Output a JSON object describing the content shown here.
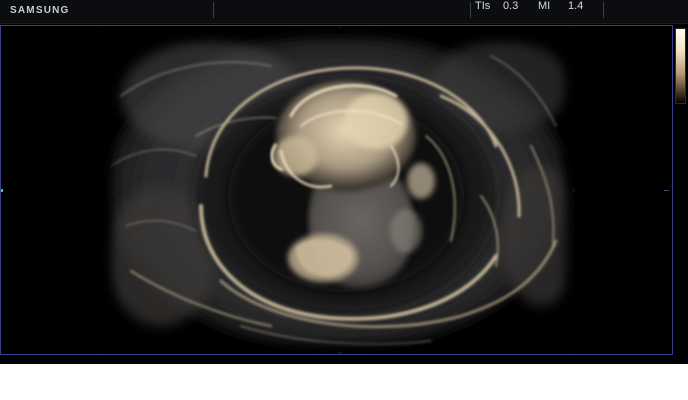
{
  "header": {
    "brand": "SAMSUNG",
    "tis_label": "TIs",
    "tis_value": "0.3",
    "mi_label": "MI",
    "mi_value": "1.4"
  },
  "colors": {
    "frame": "#3b3f8f",
    "marker": "#3fd0a6",
    "tissue": "#e8d6b4"
  },
  "icons": {
    "colorbar": "grayscale-tint-map"
  }
}
